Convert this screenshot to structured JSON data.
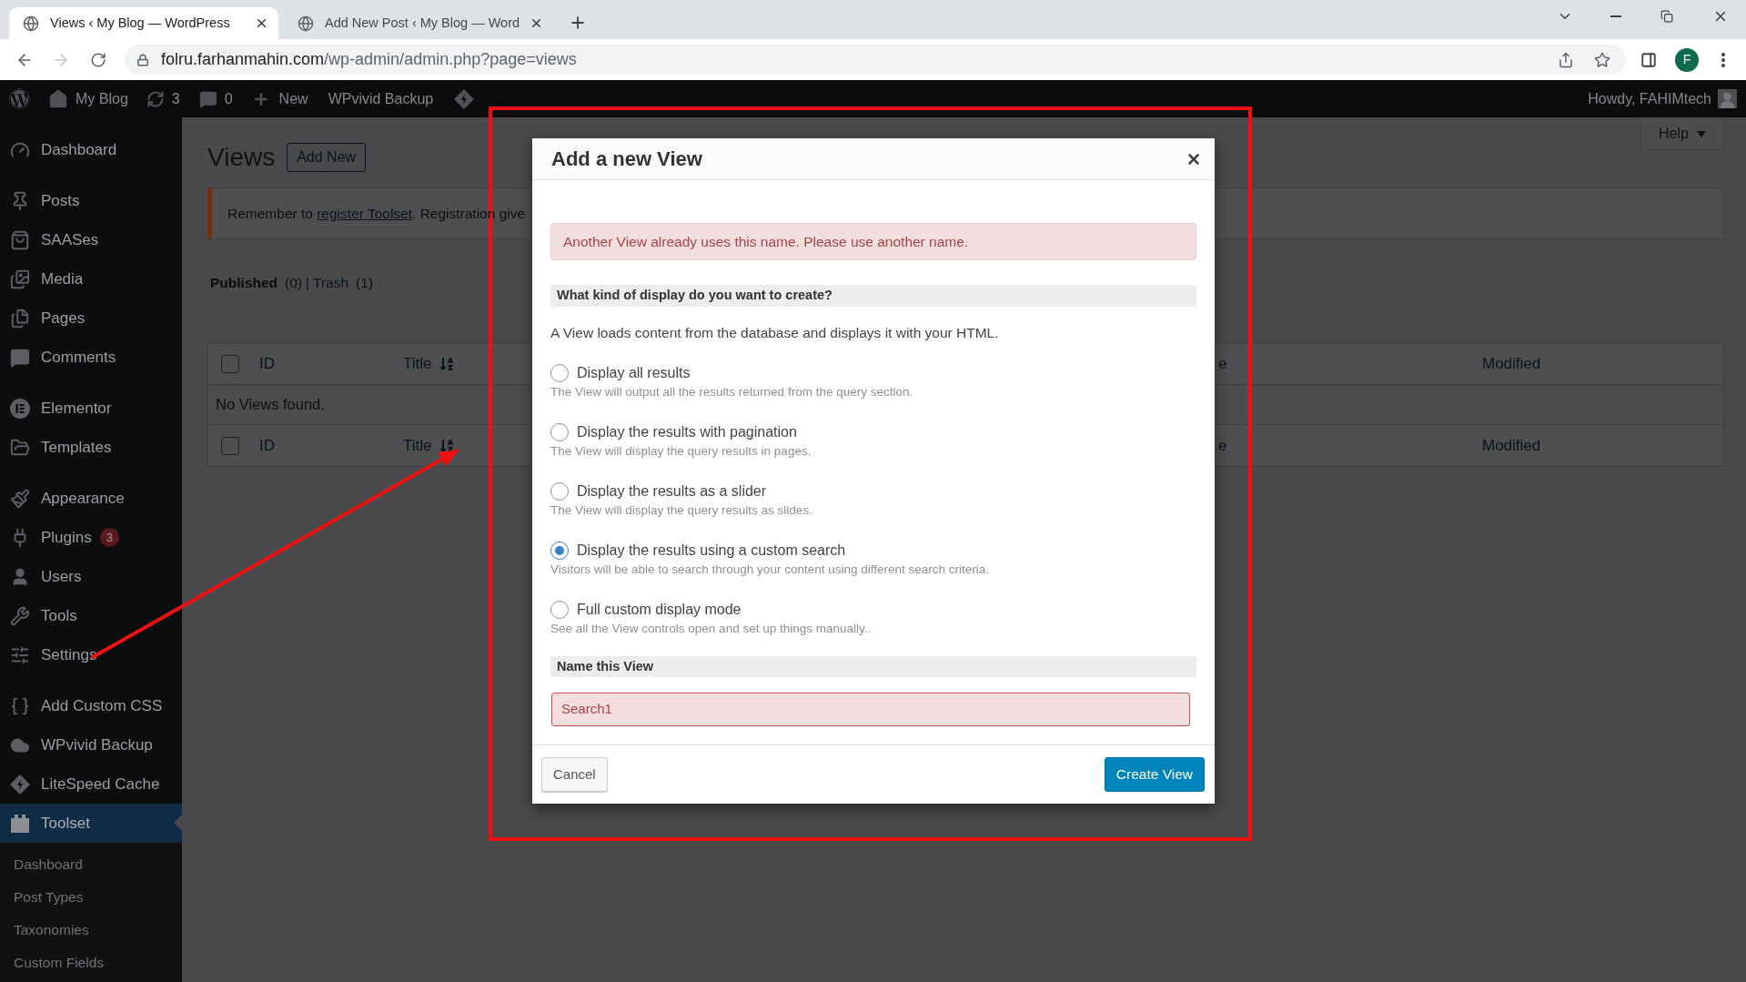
{
  "browser": {
    "tabs": [
      {
        "title": "Views ‹ My Blog — WordPress",
        "selected": true
      },
      {
        "title": "Add New Post ‹ My Blog — Word",
        "selected": false
      }
    ],
    "url": {
      "host": "folru.farhanmahin.com",
      "path": "/wp-admin/admin.php?page=views"
    },
    "profile_initial": "F"
  },
  "admin_bar": {
    "site_name": "My Blog",
    "updates_count": "3",
    "comments_count": "0",
    "new_label": "New",
    "backup_label": "WPvivid Backup",
    "greeting": "Howdy, FAHIMtech"
  },
  "sidebar": {
    "groups": [
      {
        "items": [
          {
            "label": "Dashboard",
            "selected": false
          }
        ]
      },
      {
        "items": [
          {
            "label": "Posts",
            "selected": false
          },
          {
            "label": "SAASes",
            "selected": false
          },
          {
            "label": "Media",
            "selected": false
          },
          {
            "label": "Pages",
            "selected": false
          },
          {
            "label": "Comments",
            "selected": false
          }
        ]
      },
      {
        "items": [
          {
            "label": "Elementor",
            "selected": false
          },
          {
            "label": "Templates",
            "selected": false
          }
        ]
      },
      {
        "items": [
          {
            "label": "Appearance",
            "selected": false
          },
          {
            "label": "Plugins",
            "selected": false,
            "badge": "3"
          },
          {
            "label": "Users",
            "selected": false
          },
          {
            "label": "Tools",
            "selected": false
          },
          {
            "label": "Settings",
            "selected": false
          }
        ]
      },
      {
        "items": [
          {
            "label": "Add Custom CSS",
            "selected": false
          },
          {
            "label": "WPvivid Backup",
            "selected": false
          },
          {
            "label": "LiteSpeed Cache",
            "selected": false
          },
          {
            "label": "Toolset",
            "selected": true,
            "submenu": [
              {
                "label": "Dashboard",
                "selected": false
              },
              {
                "label": "Post Types",
                "selected": false
              },
              {
                "label": "Taxonomies",
                "selected": false
              },
              {
                "label": "Custom Fields",
                "selected": false
              }
            ]
          }
        ]
      }
    ]
  },
  "page": {
    "title": "Views",
    "add_new": "Add New",
    "help": "Help",
    "notice": {
      "before": "Remember to ",
      "link": "register Toolset",
      "after": ". Registration give"
    },
    "filters": [
      {
        "label": "Published",
        "count": "(0)",
        "selected": true
      },
      {
        "label": "Trash",
        "count": "(1)",
        "selected": false
      }
    ],
    "filter_separator": "|",
    "table": {
      "header": {
        "checked": false,
        "columns": [
          {
            "label": "ID",
            "sortable": false
          },
          {
            "label": "Title",
            "sortable": true
          },
          {
            "label": "e",
            "sortable": false
          },
          {
            "label": "Modified",
            "sortable": false
          }
        ]
      },
      "empty_message": "No Views found.",
      "footer": {
        "checked": false,
        "columns": [
          {
            "label": "ID",
            "sortable": false
          },
          {
            "label": "Title",
            "sortable": true
          },
          {
            "label": "e",
            "sortable": false
          },
          {
            "label": "Modified",
            "sortable": false
          }
        ]
      }
    }
  },
  "dialog": {
    "title": "Add a new View",
    "error": "Another View already uses this name. Please use another name.",
    "display_heading": "What kind of display do you want to create?",
    "intro": "A View loads content from the database and displays it with your HTML.",
    "options": [
      {
        "label": "Display all results",
        "description": "The View will output all the results returned from the query section.",
        "selected": false
      },
      {
        "label": "Display the results with pagination",
        "description": "The View will display the query results in pages.",
        "selected": false
      },
      {
        "label": "Display the results as a slider",
        "description": "The View will display the query results as slides.",
        "selected": false
      },
      {
        "label": "Display the results using a custom search",
        "description": "Visitors will be able to search through your content using different search criteria.",
        "selected": true
      },
      {
        "label": "Full custom display mode",
        "description": "See all the View controls open and set up things manually..",
        "selected": false
      }
    ],
    "name_heading": "Name this View",
    "name_value": "Search1",
    "name_invalid": true,
    "cancel": "Cancel",
    "create": "Create View"
  }
}
